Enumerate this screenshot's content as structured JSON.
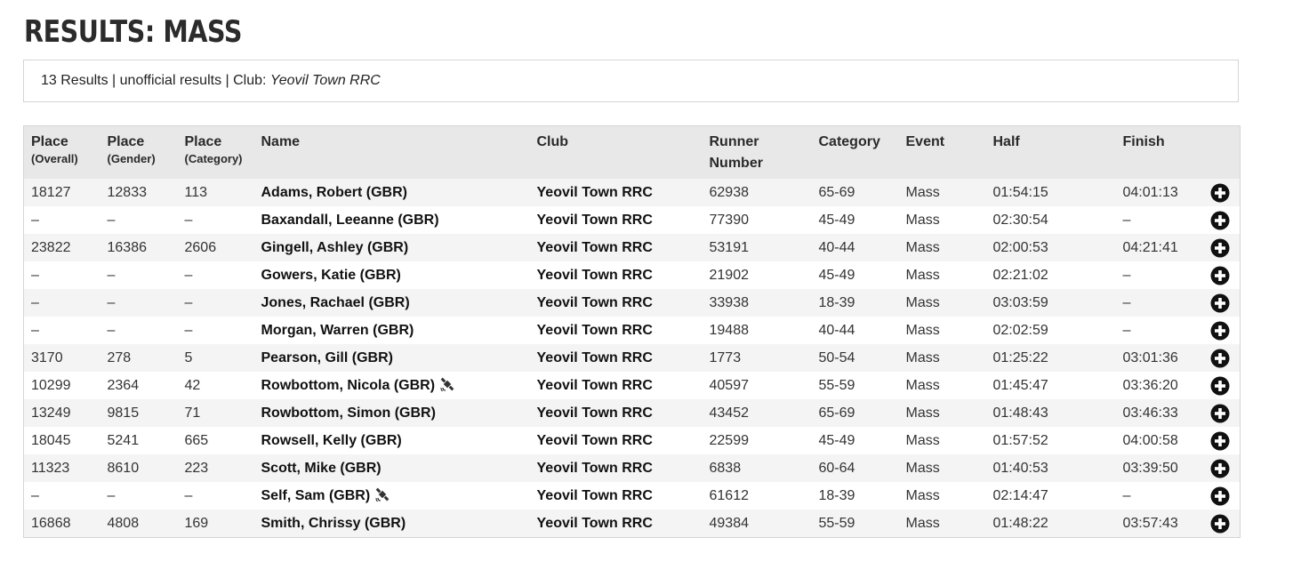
{
  "page": {
    "title": "RESULTS: MASS"
  },
  "summary": {
    "text": "13 Results | unofficial results | Club: ",
    "club": "Yeovil Town RRC"
  },
  "columns": [
    {
      "label": "Place",
      "sub": "(Overall)"
    },
    {
      "label": "Place",
      "sub": "(Gender)"
    },
    {
      "label": "Place",
      "sub": "(Category)"
    },
    {
      "label": "Name",
      "sub": ""
    },
    {
      "label": "Club",
      "sub": ""
    },
    {
      "label": "Runner",
      "sub": "Number"
    },
    {
      "label": "Category",
      "sub": ""
    },
    {
      "label": "Event",
      "sub": ""
    },
    {
      "label": "Half",
      "sub": ""
    },
    {
      "label": "Finish",
      "sub": ""
    }
  ],
  "icons": {
    "expand": "plus-circle-icon",
    "tracker": "satellite-tracking-icon"
  },
  "rows": [
    {
      "overall": "18127",
      "gender": "12833",
      "category_place": "113",
      "name": "Adams, Robert (GBR)",
      "tracked": false,
      "club": "Yeovil Town RRC",
      "number": "62938",
      "category": "65-69",
      "event": "Mass",
      "half": "01:54:15",
      "finish": "04:01:13"
    },
    {
      "overall": "–",
      "gender": "–",
      "category_place": "–",
      "name": "Baxandall, Leeanne (GBR)",
      "tracked": false,
      "club": "Yeovil Town RRC",
      "number": "77390",
      "category": "45-49",
      "event": "Mass",
      "half": "02:30:54",
      "finish": "–"
    },
    {
      "overall": "23822",
      "gender": "16386",
      "category_place": "2606",
      "name": "Gingell, Ashley (GBR)",
      "tracked": false,
      "club": "Yeovil Town RRC",
      "number": "53191",
      "category": "40-44",
      "event": "Mass",
      "half": "02:00:53",
      "finish": "04:21:41"
    },
    {
      "overall": "–",
      "gender": "–",
      "category_place": "–",
      "name": "Gowers, Katie (GBR)",
      "tracked": false,
      "club": "Yeovil Town RRC",
      "number": "21902",
      "category": "45-49",
      "event": "Mass",
      "half": "02:21:02",
      "finish": "–"
    },
    {
      "overall": "–",
      "gender": "–",
      "category_place": "–",
      "name": "Jones, Rachael (GBR)",
      "tracked": false,
      "club": "Yeovil Town RRC",
      "number": "33938",
      "category": "18-39",
      "event": "Mass",
      "half": "03:03:59",
      "finish": "–"
    },
    {
      "overall": "–",
      "gender": "–",
      "category_place": "–",
      "name": "Morgan, Warren (GBR)",
      "tracked": false,
      "club": "Yeovil Town RRC",
      "number": "19488",
      "category": "40-44",
      "event": "Mass",
      "half": "02:02:59",
      "finish": "–"
    },
    {
      "overall": "3170",
      "gender": "278",
      "category_place": "5",
      "name": "Pearson, Gill (GBR)",
      "tracked": false,
      "club": "Yeovil Town RRC",
      "number": "1773",
      "category": "50-54",
      "event": "Mass",
      "half": "01:25:22",
      "finish": "03:01:36"
    },
    {
      "overall": "10299",
      "gender": "2364",
      "category_place": "42",
      "name": "Rowbottom, Nicola (GBR)",
      "tracked": true,
      "club": "Yeovil Town RRC",
      "number": "40597",
      "category": "55-59",
      "event": "Mass",
      "half": "01:45:47",
      "finish": "03:36:20"
    },
    {
      "overall": "13249",
      "gender": "9815",
      "category_place": "71",
      "name": "Rowbottom, Simon (GBR)",
      "tracked": false,
      "club": "Yeovil Town RRC",
      "number": "43452",
      "category": "65-69",
      "event": "Mass",
      "half": "01:48:43",
      "finish": "03:46:33"
    },
    {
      "overall": "18045",
      "gender": "5241",
      "category_place": "665",
      "name": "Rowsell, Kelly (GBR)",
      "tracked": false,
      "club": "Yeovil Town RRC",
      "number": "22599",
      "category": "45-49",
      "event": "Mass",
      "half": "01:57:52",
      "finish": "04:00:58"
    },
    {
      "overall": "11323",
      "gender": "8610",
      "category_place": "223",
      "name": "Scott, Mike (GBR)",
      "tracked": false,
      "club": "Yeovil Town RRC",
      "number": "6838",
      "category": "60-64",
      "event": "Mass",
      "half": "01:40:53",
      "finish": "03:39:50"
    },
    {
      "overall": "–",
      "gender": "–",
      "category_place": "–",
      "name": "Self, Sam (GBR)",
      "tracked": true,
      "club": "Yeovil Town RRC",
      "number": "61612",
      "category": "18-39",
      "event": "Mass",
      "half": "02:14:47",
      "finish": "–"
    },
    {
      "overall": "16868",
      "gender": "4808",
      "category_place": "169",
      "name": "Smith, Chrissy (GBR)",
      "tracked": false,
      "club": "Yeovil Town RRC",
      "number": "49384",
      "category": "55-59",
      "event": "Mass",
      "half": "01:48:22",
      "finish": "03:57:43"
    }
  ]
}
